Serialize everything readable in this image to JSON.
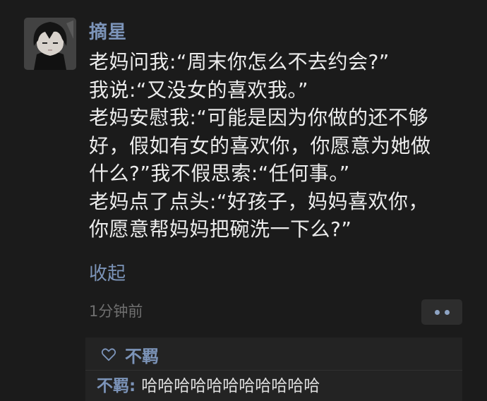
{
  "post": {
    "author": "摘星",
    "lines": [
      "老妈问我:“周末你怎么不去约会?”",
      "我说:“又没女的喜欢我。”",
      "老妈安慰我:“可能是因为你做的还不够",
      "好，假如有女的喜欢你，你愿意为她做",
      "什么?”我不假思索:“任何事。”",
      "老妈点了点头:“好孩子，妈妈喜欢你，",
      "你愿意帮妈妈把碗洗一下么?”"
    ],
    "collapse_label": "收起",
    "time": "1分钟前",
    "avatar_icon": "anime-avatar-icon",
    "more_icon": "more-dots-icon"
  },
  "feedback": {
    "like_icon": "heart-outline-icon",
    "likers": "不羁",
    "comments": [
      {
        "author": "不羁",
        "separator": ": ",
        "text": "哈哈哈哈哈哈哈哈哈哈哈"
      }
    ]
  },
  "colors": {
    "background": "#1b1b1b",
    "name_link": "#7c94b9",
    "text": "#ececec",
    "muted": "#6f6f6f",
    "panel": "#232323"
  }
}
